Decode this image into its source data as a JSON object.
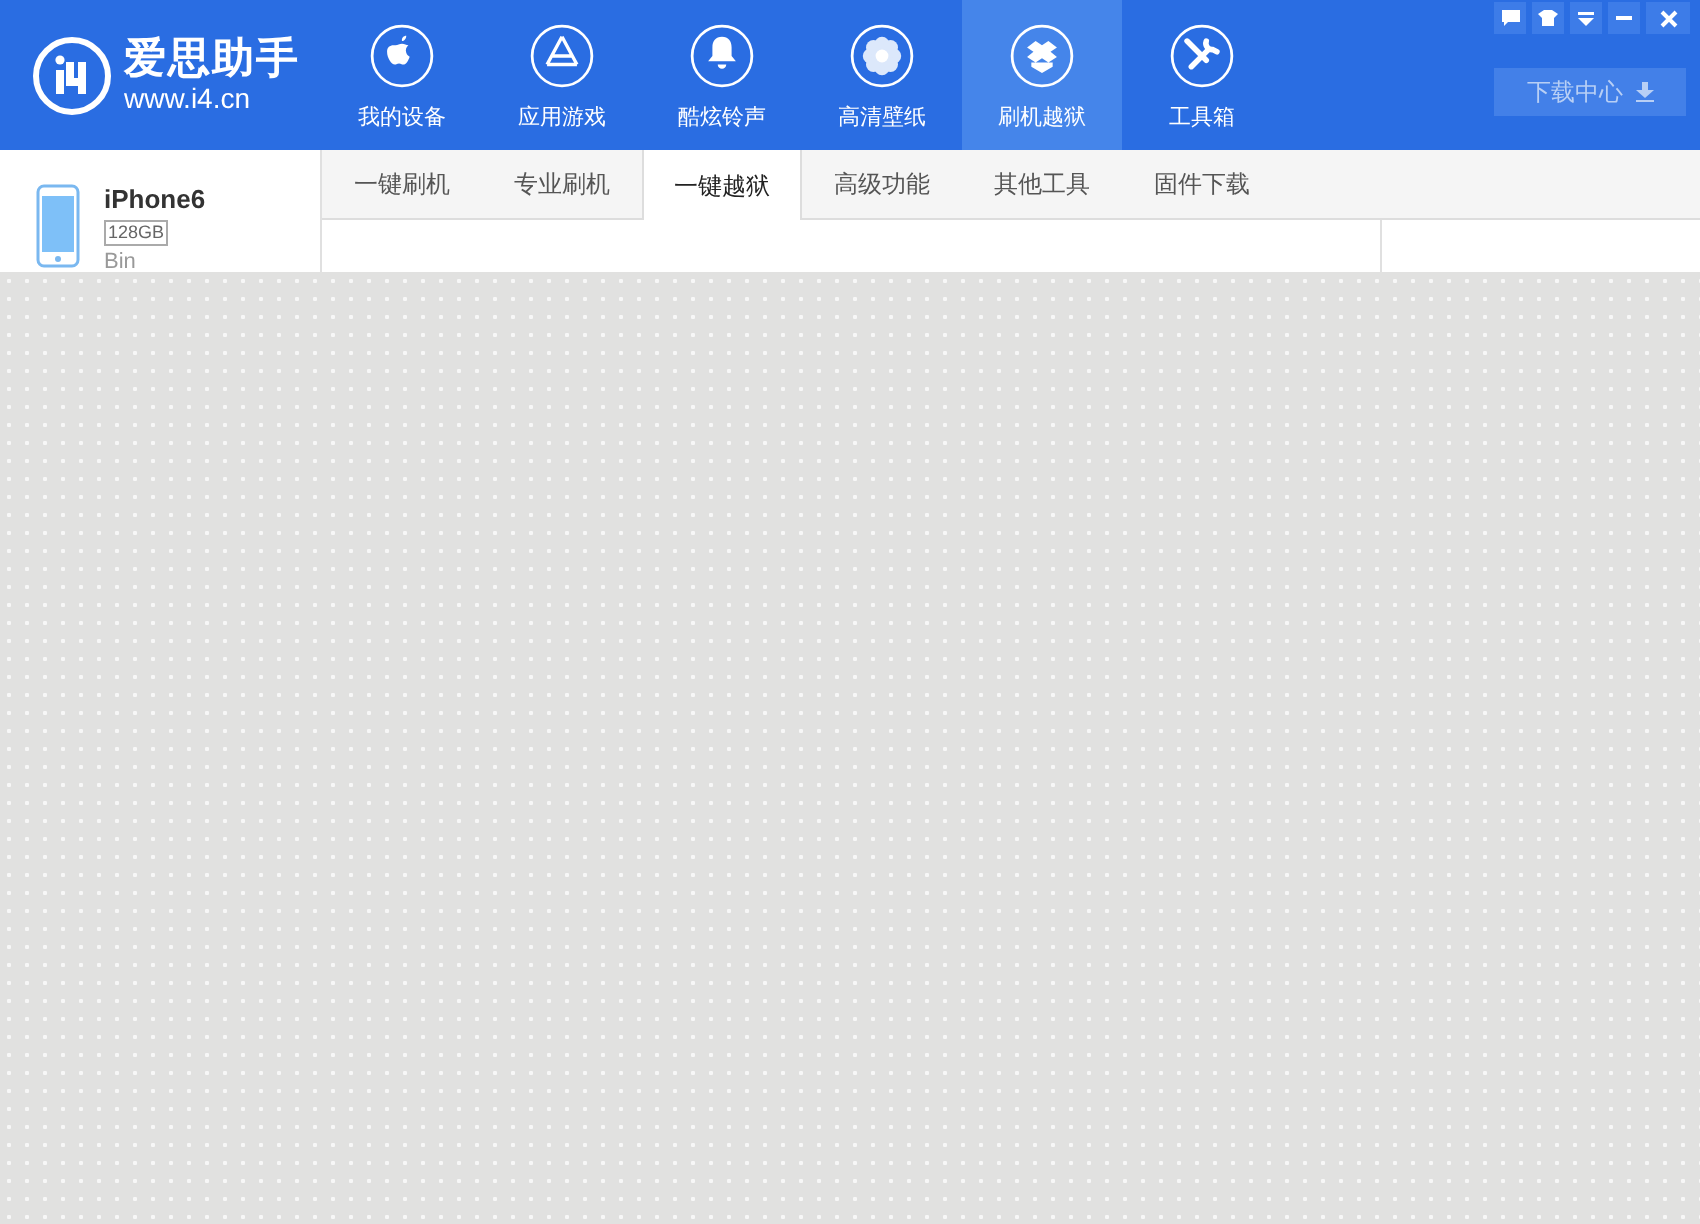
{
  "app": {
    "name": "爱思助手",
    "url": "www.i4.cn"
  },
  "nav": [
    {
      "label": "我的设备",
      "selected": false
    },
    {
      "label": "应用游戏",
      "selected": false
    },
    {
      "label": "酷炫铃声",
      "selected": false
    },
    {
      "label": "高清壁纸",
      "selected": false
    },
    {
      "label": "刷机越狱",
      "selected": true
    },
    {
      "label": "工具箱",
      "selected": false
    }
  ],
  "download_button": "下载中心",
  "device": {
    "name": "iPhone6",
    "capacity": "128GB",
    "owner": "Bin"
  },
  "tabs": [
    {
      "label": "一键刷机",
      "selected": false
    },
    {
      "label": "专业刷机",
      "selected": false
    },
    {
      "label": "一键越狱",
      "selected": true
    },
    {
      "label": "高级功能",
      "selected": false
    },
    {
      "label": "其他工具",
      "selected": false
    },
    {
      "label": "固件下载",
      "selected": false
    }
  ]
}
